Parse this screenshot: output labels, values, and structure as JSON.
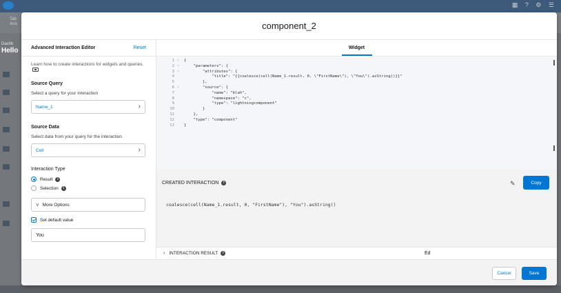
{
  "background": {
    "tab_line1": "Tab",
    "tab_line2": "Ana",
    "left_small": "Dashb",
    "left_title": "Hello",
    "top_icons": "▦ ? ⚙ ☰"
  },
  "modal": {
    "title": "component_2"
  },
  "left_panel": {
    "title": "Advanced Interaction Editor",
    "reset_label": "Reset",
    "help_text": "Learn how to create interactions for widgets and queries.",
    "source_query": {
      "title": "Source Query",
      "subtitle": "Select a query for your interaction",
      "value": "Name_1"
    },
    "source_data": {
      "title": "Source Data",
      "subtitle": "Select data from your query for the interaction",
      "value": "Cell"
    },
    "interaction_type": {
      "title": "Interaction Type",
      "options": [
        {
          "label": "Result",
          "selected": true
        },
        {
          "label": "Selection",
          "selected": false
        }
      ]
    },
    "more_options_label": "More Options",
    "set_default_label": "Set default value",
    "default_value": "You"
  },
  "right_panel": {
    "tab_label": "Widget",
    "code_lines": [
      {
        "n": "1",
        "fold": "˅",
        "text": "{"
      },
      {
        "n": "2",
        "fold": "˅",
        "text": "    \"parameters\": {"
      },
      {
        "n": "3",
        "fold": "˅",
        "text": "        \"attributes\": {"
      },
      {
        "n": "4",
        "fold": "",
        "text": "            \"title\": \"{{coalesce(cell(Name_1.result, 0, \\\"FirstName\\\"), \\\"You\\\").asString()}}\""
      },
      {
        "n": "5",
        "fold": "",
        "text": "        },"
      },
      {
        "n": "6",
        "fold": "˅",
        "text": "        \"source\": {"
      },
      {
        "n": "7",
        "fold": "",
        "text": "            \"name\": \"blah\","
      },
      {
        "n": "8",
        "fold": "",
        "text": "            \"namespace\": \"c\","
      },
      {
        "n": "9",
        "fold": "",
        "text": "            \"type\": \"lightningcomponent\""
      },
      {
        "n": "10",
        "fold": "",
        "text": "        }"
      },
      {
        "n": "11",
        "fold": "",
        "text": "    },"
      },
      {
        "n": "12",
        "fold": "",
        "text": "    \"type\": \"component\""
      },
      {
        "n": "13",
        "fold": "",
        "text": "}"
      }
    ],
    "created_label": "CREATED INTERACTION",
    "copy_label": "Copy",
    "created_code": "coalesce(cell(Name_1.result, 0, \"FirstName\"), \"You\").asString()",
    "result_label": "INTERACTION RESULT",
    "result_value": "Ed"
  },
  "footer": {
    "cancel_label": "Cancel",
    "save_label": "Save"
  },
  "colors": {
    "accent": "#0176d3",
    "code_bg": "#f4f6f9"
  }
}
